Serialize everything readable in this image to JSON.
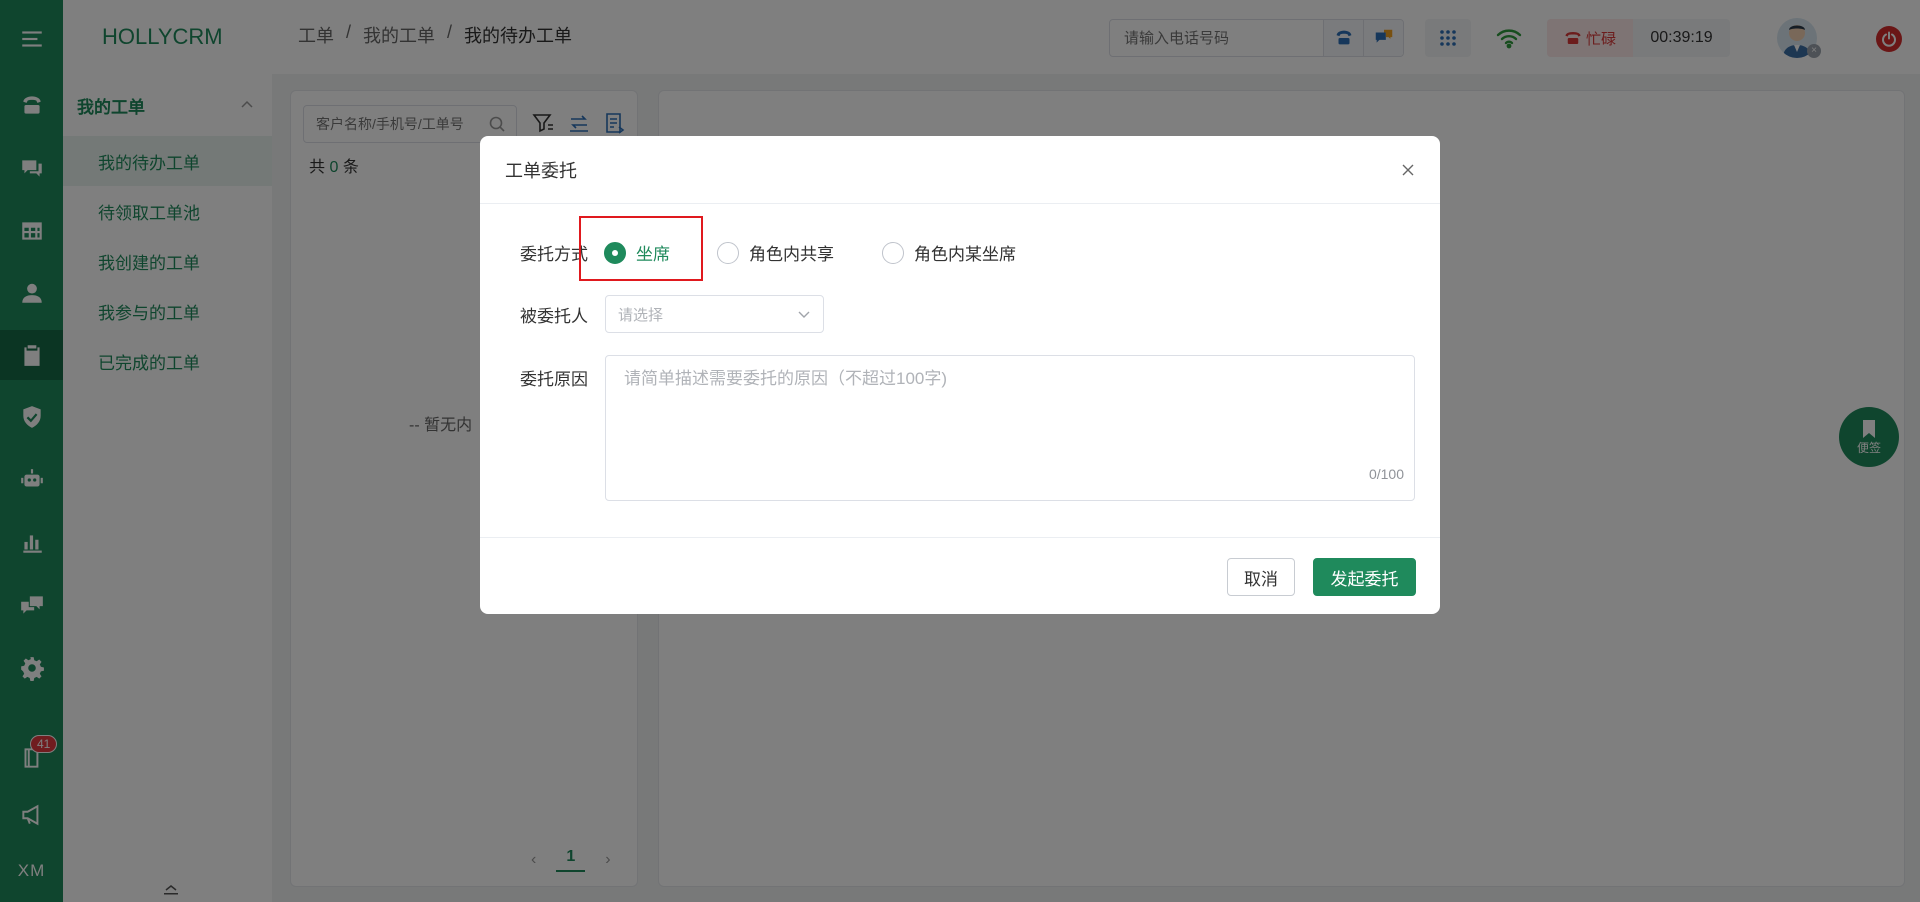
{
  "app": {
    "logo": "HOLLYCRM"
  },
  "rail": {
    "badge_count": "41",
    "footer_text": "XM",
    "icons": [
      "menu-icon",
      "phone-icon",
      "chat-icon",
      "table-icon",
      "user-icon",
      "clipboard-icon",
      "shield-icon",
      "robot-icon",
      "bar-chart-icon",
      "message-icon",
      "gear-icon",
      "book-icon",
      "megaphone-icon"
    ]
  },
  "menu": {
    "group_label": "我的工单",
    "items": [
      {
        "label": "我的待办工单"
      },
      {
        "label": "待领取工单池"
      },
      {
        "label": "我创建的工单"
      },
      {
        "label": "我参与的工单"
      },
      {
        "label": "已完成的工单"
      }
    ]
  },
  "header": {
    "breadcrumb": [
      "工单",
      "我的工单",
      "我的待办工单"
    ],
    "separator": "/",
    "phone_placeholder": "请输入电话号码",
    "status_label": "忙碌",
    "timer": "00:39:19"
  },
  "list_panel": {
    "search_placeholder": "客户名称/手机号/工单号",
    "count_prefix": "共",
    "count_value": "0",
    "count_suffix": "条",
    "empty_text": "-- 暂无内",
    "page": "1"
  },
  "float_note": {
    "label": "便签"
  },
  "dialog": {
    "title": "工单委托",
    "mode_label": "委托方式",
    "mode_options": [
      {
        "label": "坐席",
        "checked": true
      },
      {
        "label": "角色内共享",
        "checked": false
      },
      {
        "label": "角色内某坐席",
        "checked": false
      }
    ],
    "assignee_label": "被委托人",
    "assignee_placeholder": "请选择",
    "reason_label": "委托原因",
    "reason_placeholder": "请简单描述需要委托的原因（不超过100字)",
    "reason_counter": "0/100",
    "cancel_label": "取消",
    "submit_label": "发起委托"
  },
  "colors": {
    "brand": "#1f8a5c",
    "danger": "#d42c2c",
    "highlight": "#e0191e"
  }
}
